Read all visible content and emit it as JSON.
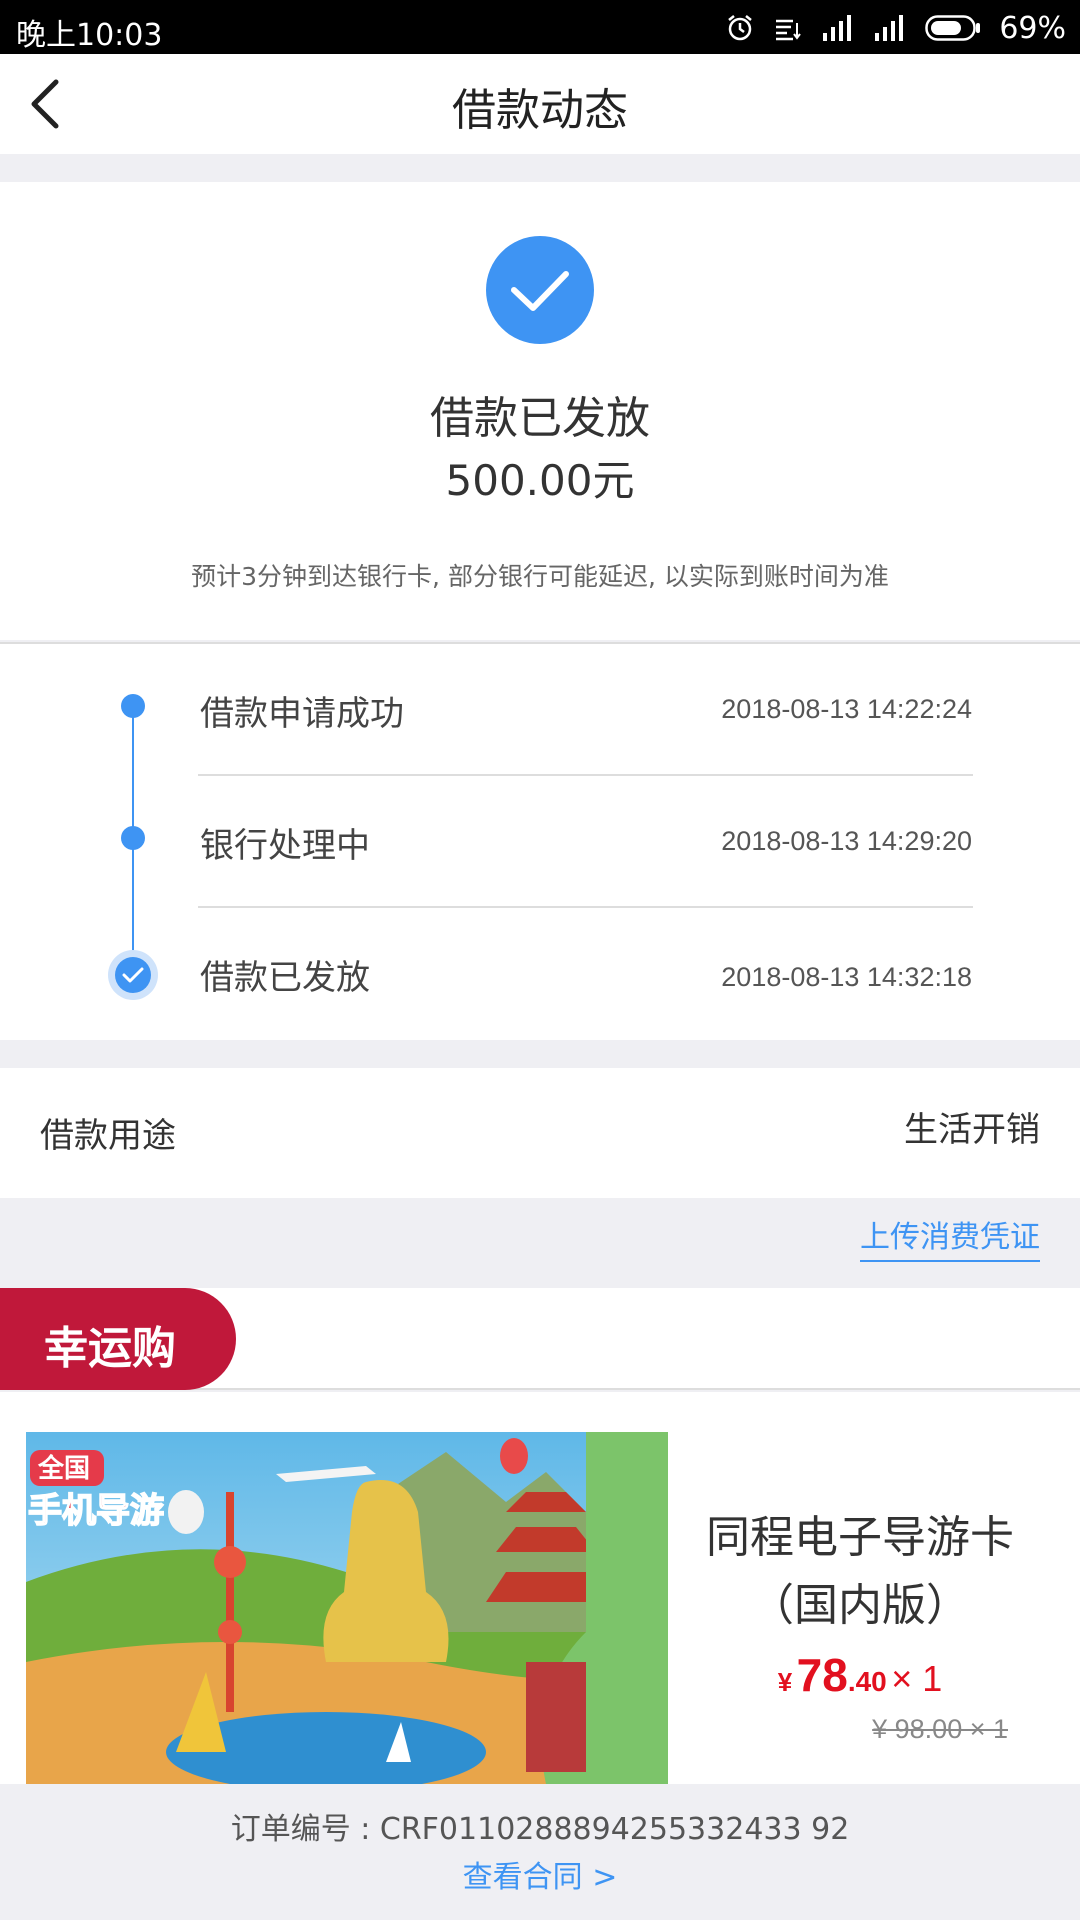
{
  "status_bar": {
    "time": "晚上10:03",
    "battery": "69%",
    "icons": [
      "alarm-icon",
      "data-icon",
      "signal-icon",
      "signal-icon",
      "battery-icon"
    ]
  },
  "nav": {
    "back_icon": "back-arrow-icon",
    "title": "借款动态"
  },
  "hero": {
    "check_icon": "check-circle-icon",
    "status": "借款已发放",
    "amount": "500.00元",
    "note": "预计3分钟到达银行卡, 部分银行可能延迟, 以实际到账时间为准",
    "accent": "#3e94f3"
  },
  "timeline": {
    "steps": [
      {
        "label": "借款申请成功",
        "time": "2018-08-13 14:22:24"
      },
      {
        "label": "银行处理中",
        "time": "2018-08-13 14:29:20"
      },
      {
        "label": "借款已发放",
        "time": "2018-08-13 14:32:18"
      }
    ]
  },
  "purpose": {
    "label": "借款用途",
    "value": "生活开销"
  },
  "upload_link": "上传消费凭证",
  "lucky": {
    "tag": "幸运购",
    "tag_color": "#c0183a"
  },
  "product": {
    "image_text": "全国手机导游",
    "name_line1": "同程电子导游卡",
    "name_line2": "（国内版）",
    "price_symbol": "¥",
    "price_int": "78",
    "price_dec": ".40",
    "quantity": "× 1",
    "original_price": "¥ 98.00 × 1",
    "price_color": "#e2101f"
  },
  "footer": {
    "order_number": "订单编号 : CRF0110288894255332433 92",
    "contract_link": "查看合同 >"
  }
}
